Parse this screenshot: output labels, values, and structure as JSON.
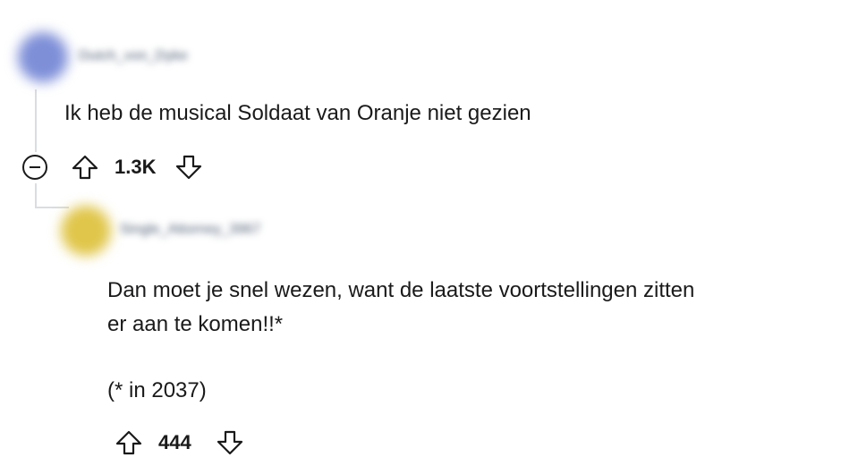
{
  "comments": [
    {
      "username": "Dutch_von_Dyke",
      "text": "Ik heb de musical Soldaat van Oranje niet gezien",
      "score": "1.3K",
      "avatar_color": "#7e8fd8"
    },
    {
      "username": "Single_Attorney_3967",
      "text_line1": "Dan moet je snel wezen, want de laatste voortstellingen zitten",
      "text_line2": "er aan te komen!!*",
      "footnote": "(* in 2037)",
      "score": "444",
      "avatar_color": "#e0c64a"
    }
  ],
  "icons": {
    "collapse": "minus-circle-icon",
    "upvote": "arrow-up-outline-icon",
    "downvote": "arrow-down-outline-icon"
  },
  "colors": {
    "thread_line": "#d9dde0",
    "text": "#1a1a1b"
  }
}
